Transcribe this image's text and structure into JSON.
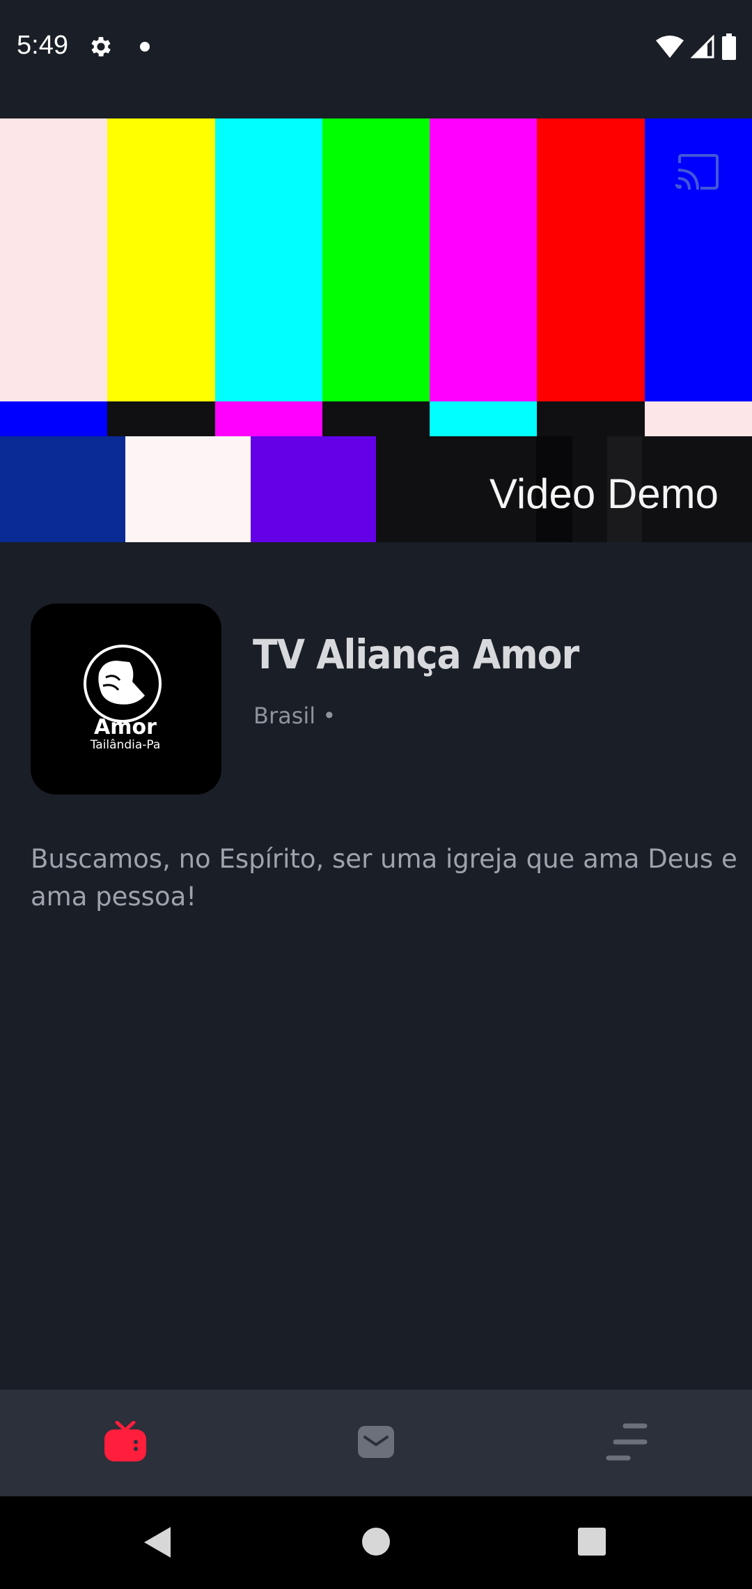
{
  "status_bar": {
    "time": "5:49",
    "icons": [
      "gear-icon",
      "notification-dot",
      "wifi-icon",
      "signal-icon",
      "battery-icon"
    ]
  },
  "video": {
    "overlay_label": "Video Demo",
    "cast_icon": "cast-icon",
    "top_bar_colors": [
      "#fde6e8",
      "#ffff00",
      "#00ffff",
      "#00ff00",
      "#ff00ff",
      "#ff0000",
      "#0000ff"
    ],
    "mid_bar_colors": [
      "#0000ff",
      "#101013",
      "#ff00ff",
      "#101013",
      "#00ffff",
      "#101013",
      "#fde6e8"
    ],
    "bottom_bar_colors": [
      "#0a2a94",
      "#fdf4f6",
      "#6300e8"
    ]
  },
  "channel": {
    "logo_text": "Amor",
    "logo_subtext": "Tailândia-Pa",
    "title": "TV Aliança Amor",
    "meta": "Brasil •",
    "description": "Buscamos, no Espírito, ser uma igreja que ama Deus e ama pessoa!"
  },
  "bottom_nav": {
    "items": [
      {
        "icon": "tv-icon",
        "active": true
      },
      {
        "icon": "mail-icon",
        "active": false
      },
      {
        "icon": "menu-icon",
        "active": false
      }
    ],
    "active_color": "#ff1e3c",
    "inactive_color": "#6b707a"
  },
  "system_nav": [
    "back-icon",
    "home-icon",
    "recents-icon"
  ]
}
